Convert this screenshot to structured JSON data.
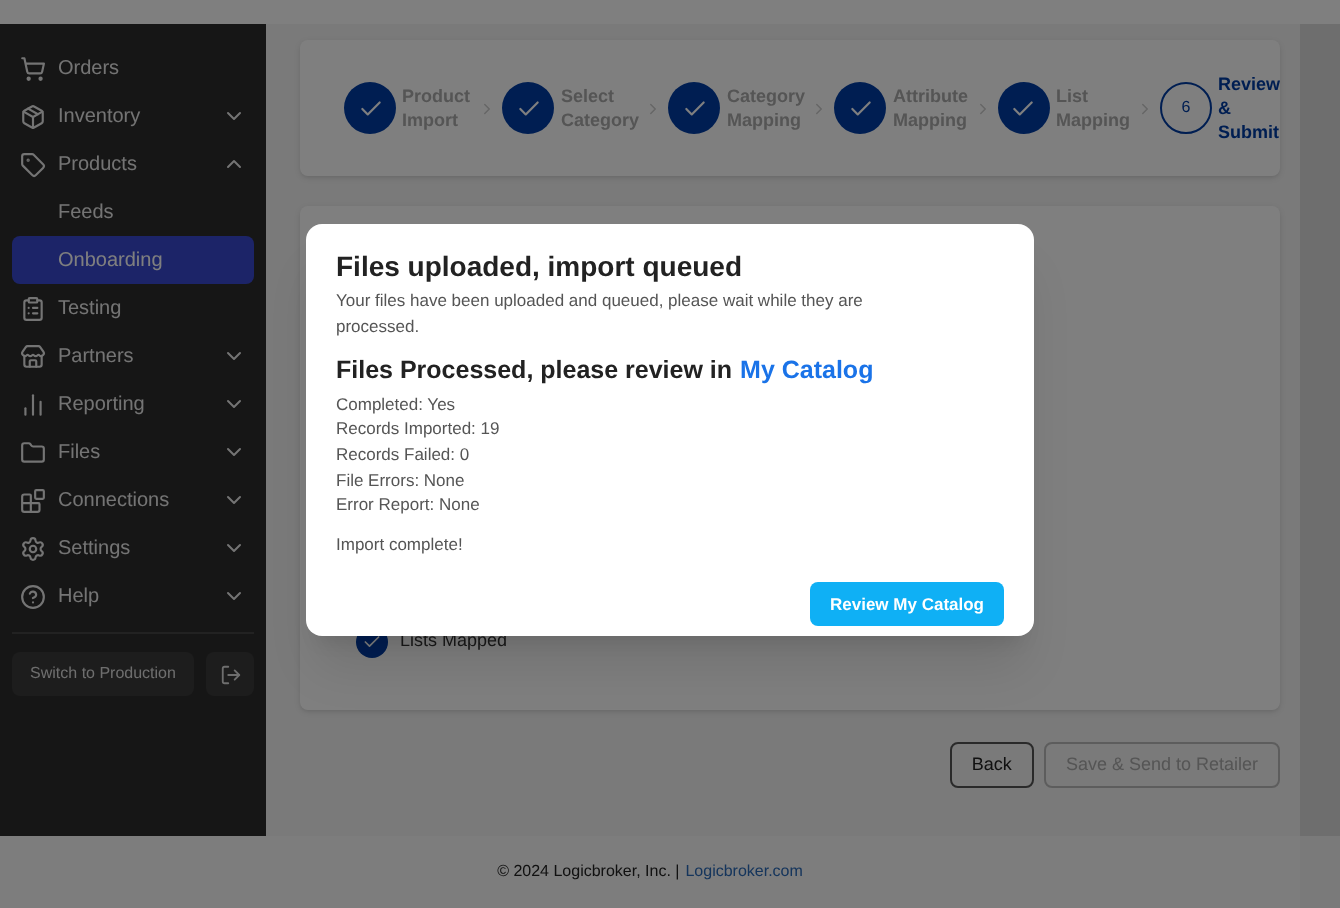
{
  "sidebar": {
    "items": [
      {
        "label": "Orders",
        "expandable": false,
        "selected": false
      },
      {
        "label": "Inventory",
        "expandable": true,
        "expanded": false,
        "selected": false
      },
      {
        "label": "Products",
        "expandable": true,
        "expanded": true,
        "selected": false,
        "children": [
          {
            "label": "Feeds",
            "selected": false
          },
          {
            "label": "Onboarding",
            "selected": true
          }
        ]
      },
      {
        "label": "Testing",
        "expandable": false,
        "selected": false
      },
      {
        "label": "Partners",
        "expandable": true,
        "expanded": false,
        "selected": false
      },
      {
        "label": "Reporting",
        "expandable": true,
        "expanded": false,
        "selected": false
      },
      {
        "label": "Files",
        "expandable": true,
        "expanded": false,
        "selected": false
      },
      {
        "label": "Connections",
        "expandable": true,
        "expanded": false,
        "selected": false
      },
      {
        "label": "Settings",
        "expandable": true,
        "expanded": false,
        "selected": false
      },
      {
        "label": "Help",
        "expandable": true,
        "expanded": false,
        "selected": false
      }
    ],
    "switch_button": "Switch to Production"
  },
  "stepper": [
    {
      "label": "Product Import",
      "done": true
    },
    {
      "label": "Select Category",
      "done": true
    },
    {
      "label": "Category Mapping",
      "done": true
    },
    {
      "label": "Attribute Mapping",
      "done": true
    },
    {
      "label": "List Mapping",
      "done": true
    },
    {
      "label": "Review & Submit",
      "done": false,
      "number": "6"
    }
  ],
  "summary_items": [
    {
      "label": "Lists Mapped",
      "done": true
    }
  ],
  "actions": [
    {
      "label": "Back",
      "disabled": false
    },
    {
      "label": "Save & Send to Retailer",
      "disabled": true
    }
  ],
  "footer": {
    "text": "© 2024 Logicbroker, Inc. |",
    "link": "Logicbroker.com"
  },
  "dialog": {
    "title": "Files uploaded, import queued",
    "message": "Your files have been uploaded and queued, please wait while they are processed.",
    "subtitle": "Files Processed, please review in",
    "subtitle_link": "My Catalog",
    "details": [
      "Completed: Yes",
      "Records Imported: 19",
      "Records Failed: 0",
      "File Errors: None",
      "Error Report: None"
    ],
    "status": "Import complete!",
    "button": "Review My Catalog"
  }
}
